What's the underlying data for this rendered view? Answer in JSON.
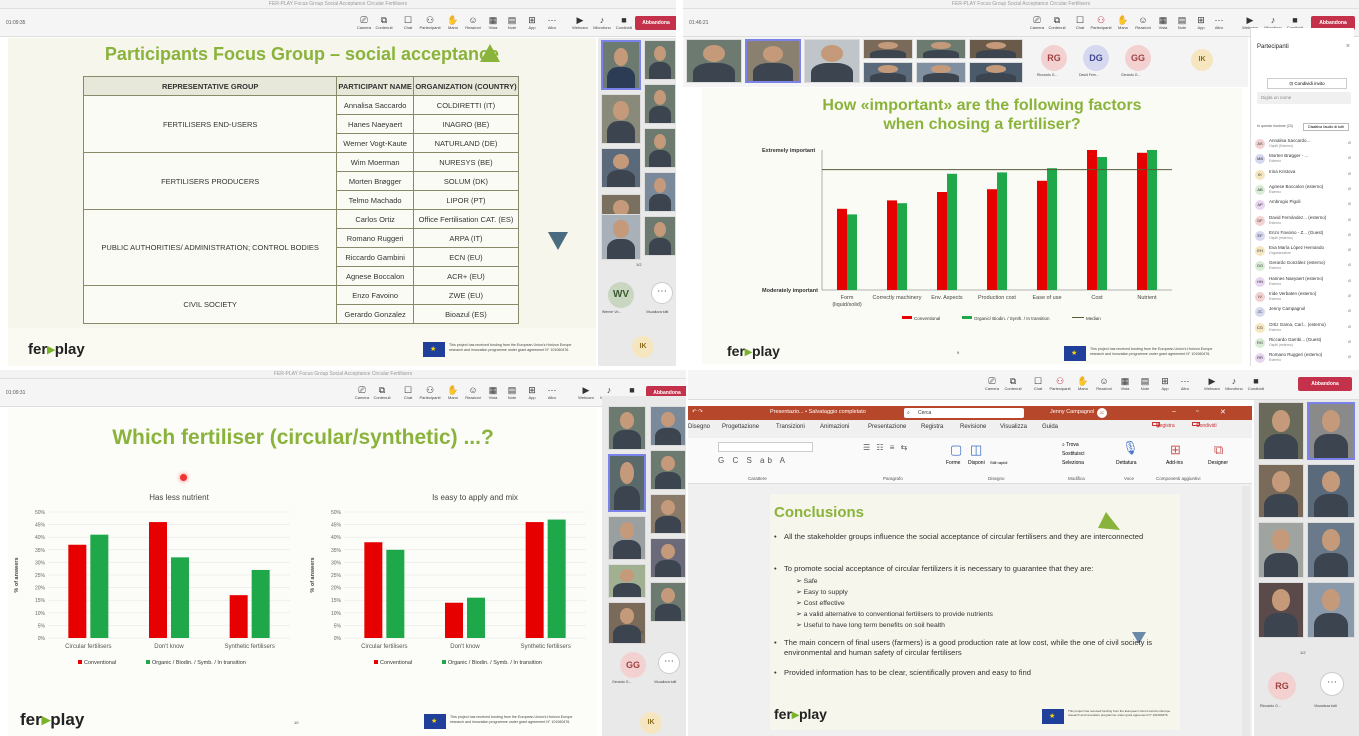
{
  "q1": {
    "timer": "01:09:35",
    "slide_title": "Participants Focus Group – social acceptance",
    "headers": [
      "REPRESENTATIVE GROUP",
      "PARTICIPANT NAME",
      "ORGANIZATION (COUNTRY)"
    ],
    "groups": [
      "FERTILISERS END-USERS",
      "FERTILISERS PRODUCERS",
      "PUBLIC AUTHORITIES/ ADMINISTRATION; CONTROL BODIES",
      "CIVIL SOCIETY"
    ],
    "rows": [
      [
        "Annalisa Saccardo",
        "COLDIRETTI (IT)"
      ],
      [
        "Hanes Naeyaert",
        "INAGRO (BE)"
      ],
      [
        "Werner Vogt-Kaute",
        "NATURLAND (DE)"
      ],
      [
        "Wim Moerman",
        "NURESYS (BE)"
      ],
      [
        "Morten Brøgger",
        "SOLUM (DK)"
      ],
      [
        "Telmo Machado",
        "LIPOR (PT)"
      ],
      [
        "Carlos Ortiz",
        "Office Fertilisation CAT. (ES)"
      ],
      [
        "Romano Ruggeri",
        "ARPA (IT)"
      ],
      [
        "Riccardo Gambini",
        "ECN (EU)"
      ],
      [
        "Agnese Boccalon",
        "ACR+ (EU)"
      ],
      [
        "Enzo Favoino",
        "ZWE (EU)"
      ],
      [
        "Gerardo Gonzalez",
        "Bioazul (ES)"
      ]
    ],
    "logo_a": "fer",
    "logo_b": "play",
    "page": "1/2",
    "wv": "WV",
    "wv_name": "Werner Vo...",
    "see_all": "Visualizza tutti",
    "ik": "IK",
    "eu_text": "This project has received funding from the European Union's Horizon Europe research and innovation programme under grant agreement N° 101060476."
  },
  "toolbar": {
    "camera": "Camera",
    "content": "Contenuti",
    "chat": "Chat",
    "people": "Partecipanti",
    "hand": "Mano",
    "react": "Reazioni",
    "view": "Vista",
    "notes": "Note",
    "apps": "App",
    "more": "Altro",
    "webcam": "Webcam",
    "mic": "Microfono",
    "share": "Condividi",
    "leave": "Abbandona",
    "count1": "16",
    "count3": "17"
  },
  "q2": {
    "timer": "01:46:21",
    "slide_title": "How «important» are the following factors when chosing a fertiliser?",
    "avatars": [
      "RG",
      "DG",
      "GG"
    ],
    "avatar_names": [
      "Riccardo G...",
      "David Fern...",
      "Gerardo G..."
    ],
    "ik": "IK",
    "panel_title": "Partecipanti",
    "invite": "Condividi invito",
    "search": "Digita un nome",
    "group": "In questa riunione (23)",
    "mute_all": "Disattiva l'audio di tutti",
    "participants": [
      {
        "i": "AS",
        "n": "Annalisa Saccardo...",
        "s": "Ospiti (Esterno)"
      },
      {
        "i": "MB",
        "n": "Morten Brøgger - ...",
        "s": "Esterno"
      },
      {
        "i": "IK",
        "n": "Irina Kristova",
        "s": ""
      },
      {
        "i": "AB",
        "n": "Agnese Boccalon (esterno)",
        "s": "Esterno"
      },
      {
        "i": "AP",
        "n": "Ambrogio Pigoli",
        "s": ""
      },
      {
        "i": "DF",
        "n": "David Fernández... (esterno)",
        "s": "Esterno"
      },
      {
        "i": "EF",
        "n": "Enzo Favoino - Z... (Guest)",
        "s": "Ospiti (esterno)"
      },
      {
        "i": "EH",
        "n": "Eva María López Hernando",
        "s": "Organizzatore"
      },
      {
        "i": "GG",
        "n": "Gerardo González (esterno)",
        "s": "Esterno"
      },
      {
        "i": "HN",
        "n": "Hannes Naeyaert (esterno)",
        "s": "Esterno"
      },
      {
        "i": "IV",
        "n": "Iride Verbaten (esterno)",
        "s": "Esterno"
      },
      {
        "i": "JC",
        "n": "Jenny Campagnol",
        "s": ""
      },
      {
        "i": "CG",
        "n": "Ortiz Gama, Carl... (esterno)",
        "s": "Esterno"
      },
      {
        "i": "RG",
        "n": "Riccardo Gambi... (Guest)",
        "s": "Ospiti (esterno)"
      },
      {
        "i": "RR",
        "n": "Romano Ruggeri (esterno)",
        "s": "Esterno"
      }
    ],
    "page": "9",
    "logo_a": "fer",
    "logo_b": "play"
  },
  "q3": {
    "timer": "01:09:31",
    "slide_title": "Which fertiliser (circular/synthetic) ...?",
    "page": "10",
    "gg": "GG",
    "gg_name": "Gerardo G...",
    "see_all": "Visualizza tutti",
    "pager": "1/2",
    "ik": "IK",
    "logo_a": "fer",
    "logo_b": "play"
  },
  "q4": {
    "app_title": "Presentazio... • Salvataggio completato",
    "search": "Cerca",
    "user": "Jenny Campagnol",
    "user_init": "JC",
    "tabs": [
      "Disegno",
      "Progettazione",
      "Transizioni",
      "Animazioni",
      "Presentazione",
      "Registra",
      "Revisione",
      "Visualizza",
      "Guida"
    ],
    "record": "Registra",
    "share": "Condividi",
    "groups": [
      "Carattere",
      "Paragrafo",
      "Disegno",
      "Modifica",
      "Voce",
      "Componenti aggiuntivi"
    ],
    "btns": [
      "Forme",
      "Disponi",
      "Stili rapidi",
      "Dettatura",
      "Add-ins",
      "Designer",
      "Trova",
      "Sostituisci",
      "Seleziona"
    ],
    "conc_title": "Conclusions",
    "b1": "All the stakeholder groups influence the social acceptance of circular fertilisers and they are interconnected",
    "b2": "To promote social acceptance of circular fertilizers it is necessary to guarantee that they are:",
    "subs": [
      "Safe",
      "Easy to supply",
      "Cost effective",
      "a valid alternative to conventional fertilisers to provide nutrients",
      "Useful to have long term benefits on soil health"
    ],
    "b3": "The main concern of final users (farmers) is a good production rate at low cost, while the one of civil society is environmental and human safety of circular fertilisers",
    "b4": "Provided information has to be clear, scientifically proven and easy to find",
    "logo_a": "fer",
    "logo_b": "play",
    "rg": "RG",
    "rg_name": "Riccardo G...",
    "see_all": "Visualizza tutti",
    "pager": "1/2"
  },
  "chart_data": [
    {
      "type": "bar",
      "categories": [
        "Form (liquid/solid)",
        "Correctly machinery",
        "Env. Aspects",
        "Production cost",
        "Ease of use",
        "Cost",
        "Nutrient"
      ],
      "series": [
        {
          "name": "Conventional",
          "values": [
            0.58,
            0.64,
            0.7,
            0.72,
            0.78,
            1.0,
            0.98
          ]
        },
        {
          "name": "Organic/ Biodin. / Synth. / In transition",
          "values": [
            0.54,
            0.62,
            0.83,
            0.84,
            0.87,
            0.95,
            1.0
          ]
        }
      ],
      "median": 0.86,
      "ylabel_top": "Extremely important",
      "ylabel_bottom": "Moderately important",
      "median_label": "Median",
      "colors": [
        "#e60000",
        "#1ea84a"
      ]
    },
    {
      "type": "bar",
      "title": "Has less nutrient",
      "categories": [
        "Circular fertilisers",
        "Don't know",
        "Synthetic fertilisers"
      ],
      "series": [
        {
          "name": "Conventional",
          "values": [
            37,
            46,
            17
          ]
        },
        {
          "name": "Organic / Biodin. / Symb. / In transition",
          "values": [
            41,
            32,
            27
          ]
        }
      ],
      "ylim": [
        0,
        50
      ],
      "yticks": [
        "0%",
        "5%",
        "10%",
        "15%",
        "20%",
        "25%",
        "30%",
        "35%",
        "40%",
        "45%",
        "50%"
      ],
      "ylabel": "% of answers"
    },
    {
      "type": "bar",
      "title": "Is easy to apply and mix",
      "categories": [
        "Circular fertilisers",
        "Don't know",
        "Synthetic fertilisers"
      ],
      "series": [
        {
          "name": "Conventional",
          "values": [
            38,
            14,
            46
          ]
        },
        {
          "name": "Organic / Biodin. / Symb. / In transition",
          "values": [
            35,
            16,
            47
          ]
        }
      ],
      "ylim": [
        0,
        50
      ],
      "yticks": [
        "0%",
        "5%",
        "10%",
        "15%",
        "20%",
        "25%",
        "30%",
        "35%",
        "40%",
        "45%",
        "50%"
      ],
      "ylabel": "% of answers"
    }
  ]
}
